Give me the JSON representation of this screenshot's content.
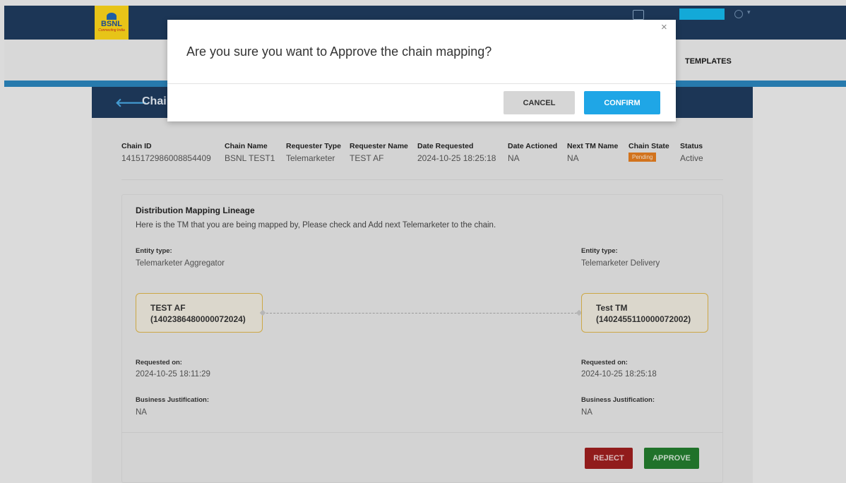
{
  "brand": {
    "logo_text": "BSNL",
    "logo_tagline": "Connecting India"
  },
  "menu": {
    "templates": "TEMPLATES"
  },
  "page": {
    "title": "Chai"
  },
  "chain": {
    "columns": [
      {
        "label": "Chain ID",
        "value": "1415172986008854409"
      },
      {
        "label": "Chain Name",
        "value": "BSNL TEST1"
      },
      {
        "label": "Requester Type",
        "value": "Telemarketer"
      },
      {
        "label": "Requester Name",
        "value": "TEST AF"
      },
      {
        "label": "Date Requested",
        "value": "2024-10-25 18:25:18"
      },
      {
        "label": "Date Actioned",
        "value": "NA"
      },
      {
        "label": "Next TM Name",
        "value": "NA"
      },
      {
        "label": "Chain State",
        "value": "Pending"
      },
      {
        "label": "Status",
        "value": "Active"
      }
    ]
  },
  "lineage": {
    "title": "Distribution Mapping Lineage",
    "description": "Here is the TM that you are being mapped by, Please check and Add next Telemarketer to the chain.",
    "left": {
      "entity_label": "Entity type:",
      "entity_value": "Telemarketer Aggregator",
      "name": "TEST AF",
      "id": "(1402386480000072024)",
      "requested_label": "Requested on:",
      "requested_value": "2024-10-25 18:11:29",
      "justification_label": "Business Justification:",
      "justification_value": "NA"
    },
    "right": {
      "entity_label": "Entity type:",
      "entity_value": "Telemarketer Delivery",
      "name": "Test TM",
      "id": "(1402455110000072002)",
      "requested_label": "Requested on:",
      "requested_value": "2024-10-25 18:25:18",
      "justification_label": "Business Justification:",
      "justification_value": "NA"
    }
  },
  "actions": {
    "reject": "REJECT",
    "approve": "APPROVE"
  },
  "modal": {
    "message": "Are you sure you want to Approve the chain mapping?",
    "close": "×",
    "cancel": "CANCEL",
    "confirm": "CONFIRM"
  },
  "icons": {
    "back": "arrow-left-icon",
    "close": "close-icon",
    "user": "user-icon"
  },
  "colors": {
    "navy": "#1e3a5c",
    "accent": "#2a82b8",
    "confirm": "#1fa6e6",
    "reject": "#9b1e1e",
    "approve": "#237a2d",
    "pending": "#e07b1f"
  }
}
